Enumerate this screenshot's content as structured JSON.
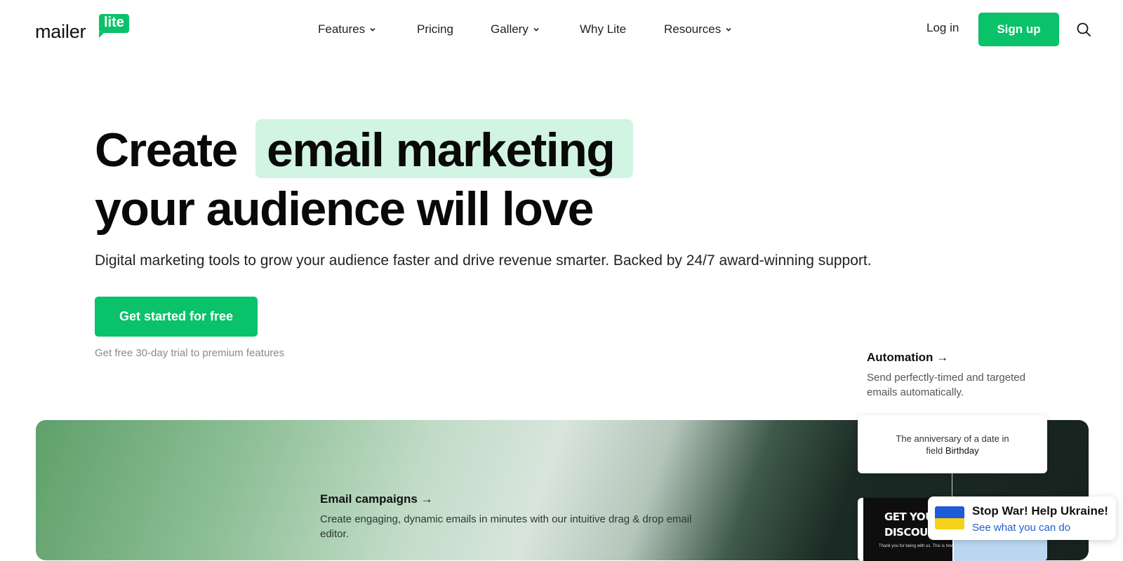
{
  "header": {
    "logo": {
      "word": "mailer",
      "badge": "lite"
    },
    "nav": [
      {
        "label": "Features",
        "has_dropdown": true
      },
      {
        "label": "Pricing",
        "has_dropdown": false
      },
      {
        "label": "Gallery",
        "has_dropdown": true
      },
      {
        "label": "Why Lite",
        "has_dropdown": false
      },
      {
        "label": "Resources",
        "has_dropdown": true
      }
    ],
    "login_label": "Log in",
    "signup_label": "Sign up",
    "search_icon": "search-icon"
  },
  "hero": {
    "headline_part1": "Create",
    "headline_highlight": "email marketing",
    "headline_line2": "your audience will love",
    "subheading": "Digital marketing tools to grow your audience faster and drive revenue smarter. Backed by 24/7 award-winning support.",
    "cta_label": "Get started for free",
    "trial_note": "Get free 30-day trial to premium features"
  },
  "features": {
    "automation": {
      "title": "Automation →",
      "description": "Send perfectly-timed and targeted emails automatically."
    },
    "automation_card": {
      "line1": "The anniversary of a date in",
      "line2_prefix": "field ",
      "line2_field": "Birthday"
    },
    "email_campaigns": {
      "title": "Email campaigns →",
      "description": "Create engaging, dynamic emails in minutes with our intuitive drag & drop email editor."
    },
    "email_preview": {
      "line1": "GET YOUR",
      "line2": "DISCOUNT",
      "small": "Thank you for being with us. This is how"
    }
  },
  "ukraine_widget": {
    "title": "Stop War! Help Ukraine!",
    "link": "See what you can do"
  },
  "colors": {
    "brand_green": "#09c269",
    "highlight": "#d2f4e2",
    "link_blue": "#1d5fd6",
    "flag_blue": "#1f5bd8",
    "flag_yellow": "#f7d117"
  }
}
